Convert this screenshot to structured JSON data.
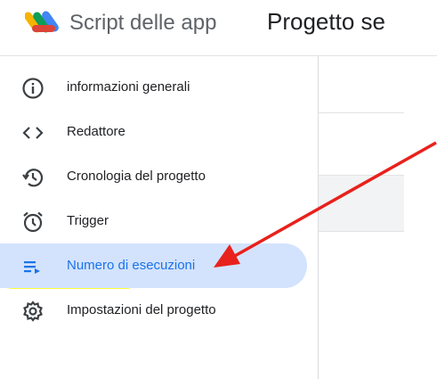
{
  "header": {
    "app_name": "Script delle app",
    "project_title": "Progetto se"
  },
  "sidebar": {
    "items": [
      {
        "label": "informazioni generali",
        "icon": "info-icon",
        "active": false
      },
      {
        "label": "Redattore",
        "icon": "code-icon",
        "active": false
      },
      {
        "label": "Cronologia del progetto",
        "icon": "history-icon",
        "active": false
      },
      {
        "label": "Trigger",
        "icon": "alarm-clock-icon",
        "active": false,
        "highlighted": true
      },
      {
        "label": "Numero di esecuzioni",
        "icon": "executions-list-icon",
        "active": true
      },
      {
        "label": "Impostazioni del progetto",
        "icon": "gear-icon",
        "active": false
      }
    ]
  },
  "colors": {
    "accent": "#1a73e8",
    "active_background": "#d3e3fd",
    "highlighter": "#ffff3b",
    "annotation_arrow": "#e8211c"
  }
}
